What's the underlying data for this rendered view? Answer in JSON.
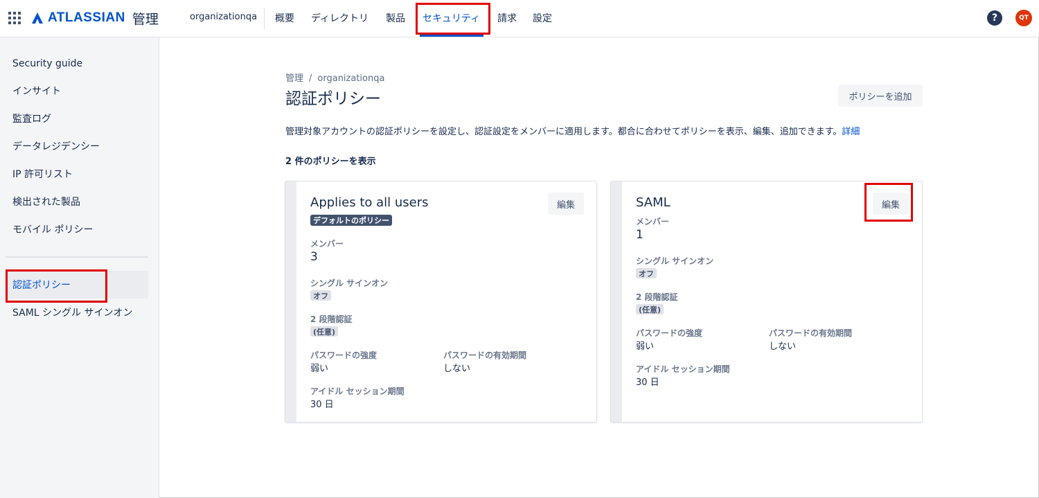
{
  "header": {
    "logo_text": "ATLASSIAN",
    "logo_suffix": "管理",
    "org": "organizationqa",
    "nav": [
      "概要",
      "ディレクトリ",
      "製品",
      "セキュリティ",
      "請求",
      "設定"
    ],
    "help_symbol": "?",
    "avatar_initials": "QT"
  },
  "sidebar": {
    "items": [
      "Security guide",
      "インサイト",
      "監査ログ",
      "データレジデンシー",
      "IP 許可リスト",
      "検出された製品",
      "モバイル ポリシー",
      "認証ポリシー",
      "SAML シングル サインオン"
    ]
  },
  "main": {
    "breadcrumb": [
      "管理",
      "organizationqa"
    ],
    "breadcrumb_sep": "/",
    "title": "認証ポリシー",
    "add_button": "ポリシーを追加",
    "description": "管理対象アカウントの認証ポリシーを設定し、認証設定をメンバーに適用します。都合に合わせてポリシーを表示、編集、追加できます。",
    "description_link": "詳細",
    "count_text": "2 件のポリシーを表示"
  },
  "cards": [
    {
      "title": "Applies to all users",
      "badge": "デフォルトのポリシー",
      "edit": "編集",
      "members_label": "メンバー",
      "members_value": "3",
      "sso_label": "シングル サインオン",
      "sso_value": "オフ",
      "tsv_label": "2 段階認証",
      "tsv_value": "(任意)",
      "pw_strength_label": "パスワードの強度",
      "pw_strength_value": "弱い",
      "pw_expiry_label": "パスワードの有効期間",
      "pw_expiry_value": "しない",
      "idle_label": "アイドル セッション期間",
      "idle_value": "30 日"
    },
    {
      "title": "SAML",
      "edit": "編集",
      "members_label": "メンバー",
      "members_value": "1",
      "sso_label": "シングル サインオン",
      "sso_value": "オフ",
      "tsv_label": "2 段階認証",
      "tsv_value": "(任意)",
      "pw_strength_label": "パスワードの強度",
      "pw_strength_value": "弱い",
      "pw_expiry_label": "パスワードの有効期間",
      "pw_expiry_value": "しない",
      "idle_label": "アイドル セッション期間",
      "idle_value": "30 日"
    }
  ],
  "colors": {
    "accent": "#0052CC",
    "highlight": "#E00000"
  }
}
